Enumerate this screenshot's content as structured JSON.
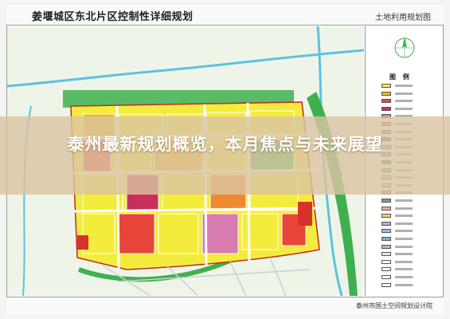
{
  "map": {
    "title": "姜堰城区东北片区控制性详细规划",
    "sheet_name": "土地利用规划图",
    "legend_heading": "图 例",
    "organization": "泰州市国土空间规划设计院",
    "legend_colors": [
      "#f7ef3a",
      "#f5b61a",
      "#e8463a",
      "#c6305b",
      "#d87bb1",
      "#f08a2e",
      "#b57ad0",
      "#8a5fb7",
      "#6fc4e6",
      "#79c66a",
      "#3ca852",
      "#b3b3b3",
      "#d9d9d9",
      "#a4d4f0",
      "#c78f63",
      "#8f8f8f",
      "#f5a6a6",
      "#e0d27b",
      "#cfa4d9",
      "#9bbcdd",
      "#7fb6c3",
      "#b9b9b9",
      "#e6e6e6",
      "#ffffff",
      "#ffffff",
      "#ffffff",
      "#ffffff"
    ]
  },
  "overlay": {
    "headline": "泰州最新规划概览，本月焦点与未来展望"
  },
  "colors": {
    "residential": "#f4ec3c",
    "commercial": "#e8463a",
    "greenspace": "#3ca852",
    "water": "#6fc4e6",
    "road": "#ffffff",
    "banner": "#dac4a2"
  }
}
